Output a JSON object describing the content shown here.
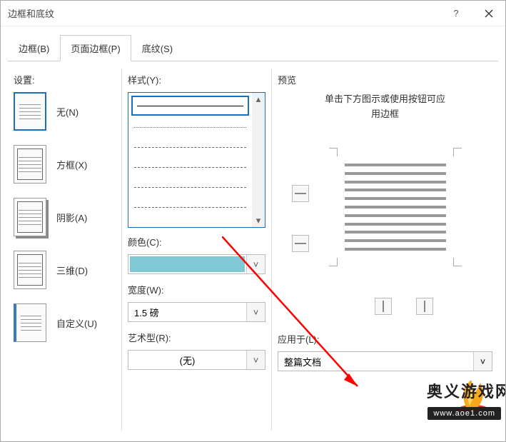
{
  "window": {
    "title": "边框和底纹"
  },
  "tabs": {
    "border": "边框(B)",
    "page_border": "页面边框(P)",
    "shading": "底纹(S)"
  },
  "settings": {
    "label": "设置:",
    "none": "无(N)",
    "box": "方框(X)",
    "shadow": "阴影(A)",
    "three_d": "三维(D)",
    "custom": "自定义(U)"
  },
  "style_label": "样式(Y):",
  "color_label": "颜色(C):",
  "color_value": "#7ec9d4",
  "width_label": "宽度(W):",
  "width_value": "1.5 磅",
  "art_label": "艺术型(R):",
  "art_value": "(无)",
  "preview": {
    "label": "预览",
    "hint1": "单击下方图示或使用按钮可应",
    "hint2": "用边框"
  },
  "apply": {
    "label": "应用于(L):",
    "value": "整篇文档"
  },
  "watermark": {
    "site_name": "奥义游戏网",
    "url": "www.aoe1.com"
  }
}
